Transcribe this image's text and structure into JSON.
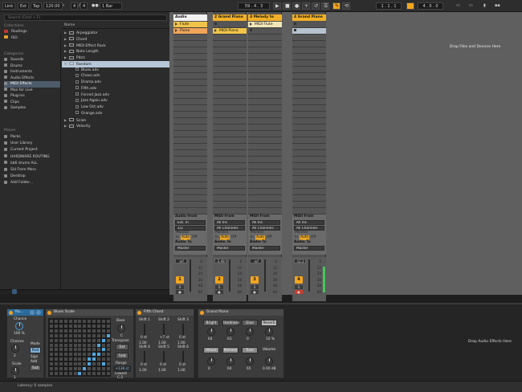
{
  "transport": {
    "link": "Link",
    "ext": "Ext",
    "tap": "Tap",
    "tempo": "120.00",
    "sig_num": "4",
    "sig_den": "4",
    "metro": "1 Bar",
    "position": "59 . 4 . 3",
    "loop_start": "1 . 1 . 1",
    "loop_len": "4 . 0 . 0"
  },
  "browser": {
    "search_placeholder": "Search (Cmd + F)",
    "collections_header": "Collections",
    "collections": [
      {
        "label": "Routings",
        "color": "#c4382e"
      },
      {
        "label": "ISO",
        "color": "#e8a02a"
      }
    ],
    "categories_header": "Categories",
    "categories": [
      "Sounds",
      "Drums",
      "Instruments",
      "Audio Effects",
      "MIDI Effects",
      "Max for Live",
      "Plug-ins",
      "Clips",
      "Samples"
    ],
    "selected_category": "MIDI Effects",
    "places_header": "Places",
    "places": [
      "Packs",
      "User Library",
      "Current Project",
      "HARDWARE ROUTING",
      "kb6 drums ALL",
      "Sid From Mars",
      "Desktop",
      "Add Folder..."
    ],
    "name_header": "Name",
    "files": [
      {
        "label": "Arpeggiator",
        "indent": 0,
        "type": "folder"
      },
      {
        "label": "Chord",
        "indent": 0,
        "type": "folder"
      },
      {
        "label": "MIDI Effect Rack",
        "indent": 0,
        "type": "folder"
      },
      {
        "label": "Note Length",
        "indent": 0,
        "type": "folder"
      },
      {
        "label": "Pitch",
        "indent": 0,
        "type": "folder"
      },
      {
        "label": "Random",
        "indent": 0,
        "type": "folder-open",
        "selected": true
      },
      {
        "label": "Blues.adv",
        "indent": 1,
        "type": "file"
      },
      {
        "label": "Chaos.adv",
        "indent": 1,
        "type": "file"
      },
      {
        "label": "Drama.adv",
        "indent": 1,
        "type": "file"
      },
      {
        "label": "Fifth.adv",
        "indent": 1,
        "type": "file"
      },
      {
        "label": "Forced Jazz.adv",
        "indent": 1,
        "type": "file"
      },
      {
        "label": "Jazz Again.adv",
        "indent": 1,
        "type": "file"
      },
      {
        "label": "Low Oct.adv",
        "indent": 1,
        "type": "file"
      },
      {
        "label": "Orange.adv",
        "indent": 1,
        "type": "file"
      },
      {
        "label": "Scale",
        "indent": 0,
        "type": "folder"
      },
      {
        "label": "Velocity",
        "indent": 0,
        "type": "folder"
      }
    ]
  },
  "tracks": [
    {
      "name": "Audio",
      "header_color": "#f2f2f2",
      "clips": [
        {
          "label": "Flute",
          "color": "#f0c44a"
        },
        {
          "label": "Piano",
          "color": "#f0a55a"
        }
      ],
      "from_label": "Audio From",
      "from": "Ext. In",
      "from2": "1/2",
      "volume": "-inf",
      "number": "1",
      "monitor": [
        "In",
        "Auto",
        "Off"
      ],
      "to_label": "Audio To",
      "to": "Master"
    },
    {
      "name": "2 Grand Piano",
      "header_color": "#f2b028",
      "clips": [
        {
          "label": "",
          "color": ""
        },
        {
          "label": "MIDI Piano",
          "color": "#f0c44a"
        }
      ],
      "from_label": "MIDI From",
      "from": "All Ins",
      "from2": "All Channels",
      "volume": "-3.49",
      "number": "2",
      "monitor": [
        "In",
        "Auto",
        "Off"
      ],
      "to_label": "Audio To",
      "to": "Master"
    },
    {
      "name": "3 Melody to",
      "header_color": "#f2b028",
      "clips": [
        {
          "label": "MIDI Flute",
          "color": "#f2e6b8"
        },
        {
          "label": "",
          "color": ""
        }
      ],
      "from_label": "MIDI From",
      "from": "All Ins",
      "from2": "All Channels",
      "volume": "-inf",
      "number": "3",
      "monitor": [
        "In",
        "Auto",
        "Off"
      ],
      "to_label": "Audio To",
      "to": "Master"
    },
    {
      "name": "4 Grand Piano",
      "header_color": "#f2b028",
      "clips": [
        {
          "label": "",
          "color": ""
        },
        {
          "label": "",
          "color": "#b6c2ce"
        }
      ],
      "from_label": "MIDI From",
      "from": "All Ins",
      "from2": "All Channels",
      "volume": "-12.2",
      "number": "4",
      "monitor": [
        "In",
        "Auto",
        "Off"
      ],
      "to_label": "Audio To",
      "to": "Master"
    }
  ],
  "meter_scale": [
    "0",
    "12",
    "24",
    "36",
    "48",
    "60"
  ],
  "session_drop": "Drop Files and Devices Here",
  "devices": {
    "random": {
      "title": "Ra...",
      "chance_label": "Chance",
      "chance": "100 %",
      "choices_label": "Choices",
      "choices": "2",
      "mode_label": "Mode",
      "mode": "Rnd",
      "sign_label": "Sign",
      "sign": "Add",
      "sub": "Sub",
      "scale_label": "Scale",
      "scale": "1"
    },
    "blues": {
      "title": "Blues Scale",
      "base_label": "Base",
      "base": "C",
      "transpose_label": "Transpose",
      "transpose": "Ext",
      "fold": "Fold",
      "range_label": "Range",
      "range": "+138 st",
      "lowest_label": "Lowest",
      "lowest": "C-2"
    },
    "fifth": {
      "title": "Fifth Chord",
      "shifts": [
        "Shift 1",
        "Shift 2",
        "Shift 3",
        "Shift 4",
        "Shift 5",
        "Shift 6"
      ],
      "row1_st": [
        "0 st",
        "+7 st",
        "0 st"
      ],
      "row1_v": [
        "1.00",
        "1.00",
        "1.00"
      ],
      "row2_st": [
        "0 st",
        "0 st",
        "0 st"
      ],
      "row2_v": [
        "1.00",
        "1.00",
        "1.00"
      ]
    },
    "piano": {
      "title": "Grand Piano",
      "macros_top": [
        "Bright",
        "Hardness",
        "Glue",
        "Reverb"
      ],
      "vals_top": [
        "64",
        "63",
        "0",
        "10 %"
      ],
      "macros_bot": [
        "Attack",
        "Release",
        "Tone",
        "Volume"
      ],
      "vals_bot": [
        "0",
        "60",
        "65",
        "0.00 dB"
      ]
    },
    "drop": "Drop Audio Effects Here"
  },
  "status": "Latency: 0 samples"
}
